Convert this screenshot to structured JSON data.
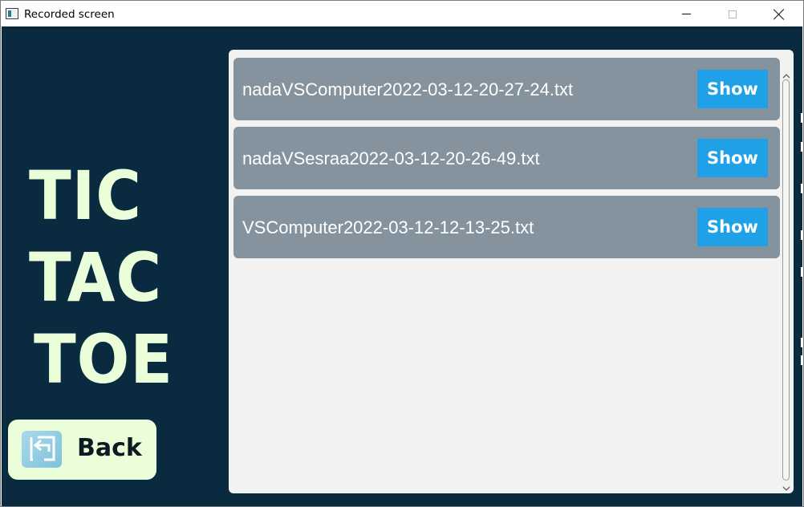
{
  "window": {
    "title": "Recorded screen",
    "icon": "app-icon"
  },
  "colors": {
    "background": "#0a2a40",
    "logo_text": "#eaffd9",
    "panel": "#f2f2f2",
    "row": "#84939d",
    "button_accent": "#1ea1e6"
  },
  "logo": {
    "lines": [
      "TIC",
      "TAC",
      "TOE"
    ]
  },
  "back": {
    "label": "Back",
    "icon": "back-arrow-icon"
  },
  "recordings": [
    {
      "filename": "nadaVSComputer2022-03-12-20-27-24.txt",
      "button_label": "Show"
    },
    {
      "filename": "nadaVSesraa2022-03-12-20-26-49.txt",
      "button_label": "Show"
    },
    {
      "filename": "VSComputer2022-03-12-12-13-25.txt",
      "button_label": "Show"
    }
  ]
}
